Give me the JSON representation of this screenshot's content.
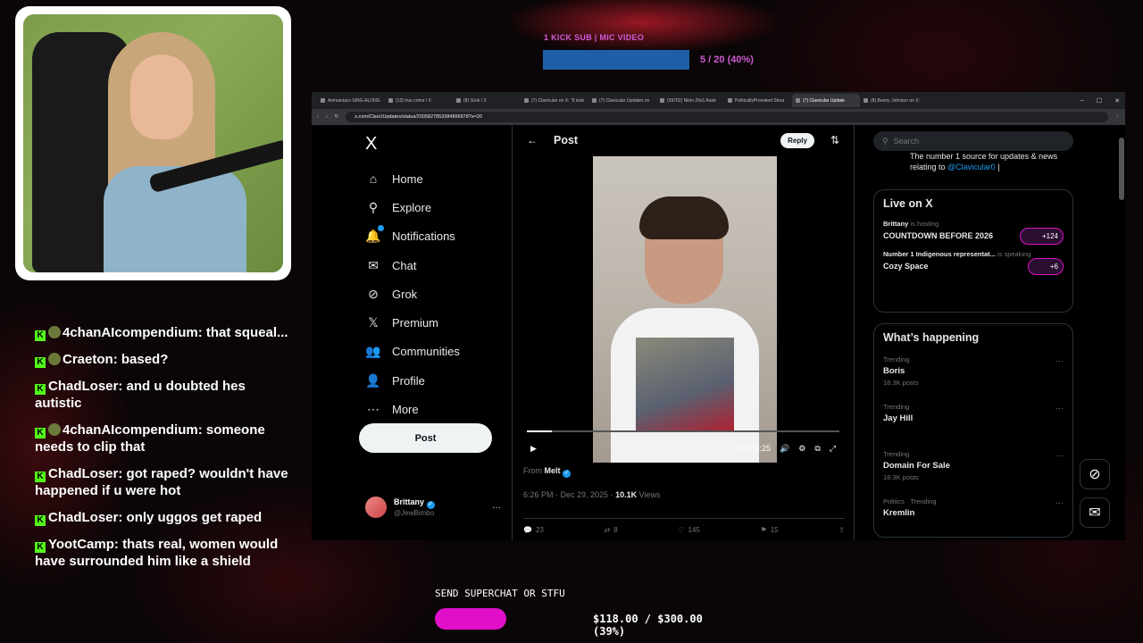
{
  "overlay": {
    "top_label": "1 KICK SUB | MIC VIDEO",
    "top_progress": "5 / 20 (40%)",
    "superchat_label": "SEND SUPERCHAT OR STFU",
    "superchat_progress": "$118.00 / $300.00 (39%)",
    "superchat_fraction": 0.39
  },
  "chat": [
    {
      "user": "4chanAIcompendium",
      "text": "that squeal..."
    },
    {
      "user": "Craeton",
      "text": "based?"
    },
    {
      "user": "ChadLoser",
      "text": "and u doubted hes autistic"
    },
    {
      "user": "4chanAIcompendium",
      "text": "someone needs to clip that"
    },
    {
      "user": "ChadLoser",
      "text": "got raped? wouldn't have happened if u were hot"
    },
    {
      "user": "ChadLoser",
      "text": "only uggos get raped"
    },
    {
      "user": "YootCamp",
      "text": "thats real, women would have surrounded him like a shield"
    }
  ],
  "browser": {
    "tabs": [
      "Animaniacs SING-ALONG",
      "(13) true crime / X",
      "(8) Grok / X",
      "(7) Clavicular on X: \"It look",
      "(7) Clavicular Updates on",
      "(39702) Nilon 20x1 Austr",
      "PoliticallyProvoked Strea",
      "(7) Clavicular Update",
      "(8) Benny Johnson on X:"
    ],
    "url": "x.com/ClavUUpdates/status/2005827853384896978?s=20"
  },
  "x_nav": {
    "logo": "X",
    "items": [
      {
        "label": "Home",
        "icon": "home-icon",
        "glyph": "⌂"
      },
      {
        "label": "Explore",
        "icon": "search-icon",
        "glyph": "⚲"
      },
      {
        "label": "Notifications",
        "icon": "bell-icon",
        "glyph": "🔔"
      },
      {
        "label": "Chat",
        "icon": "mail-icon",
        "glyph": "✉"
      },
      {
        "label": "Grok",
        "icon": "grok-icon",
        "glyph": "⊘"
      },
      {
        "label": "Premium",
        "icon": "x-premium-icon",
        "glyph": "𝕏"
      },
      {
        "label": "Communities",
        "icon": "people-icon",
        "glyph": "👥"
      },
      {
        "label": "Profile",
        "icon": "person-icon",
        "glyph": "👤"
      },
      {
        "label": "More",
        "icon": "more-circle-icon",
        "glyph": "⋯"
      }
    ],
    "post_button": "Post",
    "profile_name": "Brittany",
    "profile_handle": "@JewBimbo"
  },
  "post": {
    "header_title": "Post",
    "reply_label": "Reply",
    "video_time": "0:02 / 0:25",
    "video_progress": 0.08,
    "from_label": "From",
    "from_name": "Melt",
    "timestamp": "6:26 PM · Dec 29, 2025 · ",
    "views_count": "10.1K",
    "views_label": " Views",
    "replies": "23",
    "reposts": "8",
    "likes": "145",
    "bookmarks": "15"
  },
  "sidebar": {
    "search_placeholder": "Search",
    "snippet_text": "The number 1 source for updates & news relating to ",
    "snippet_link": "@Clavicular0",
    "snippet_tail": " |",
    "live_title": "Live on X",
    "live": [
      {
        "host": "Brittany",
        "status": " is hosting",
        "title": "COUNTDOWN BEFORE 2026",
        "count": "+124"
      },
      {
        "host": "Number 1 Indigenous representat...",
        "status": " is speaking",
        "title": "Cozy Space",
        "count": "+6"
      }
    ],
    "trends_title": "What’s happening",
    "trends": [
      {
        "category": "Trending",
        "name": "Boris",
        "count": "18.3K posts"
      },
      {
        "category": "Trending",
        "name": "Jay Hill",
        "count": ""
      },
      {
        "category": "Trending",
        "name": "Domain For Sale",
        "count": "18.3K posts"
      },
      {
        "category": "Politics · Trending",
        "name": "Kremlin",
        "count": ""
      }
    ]
  },
  "colors": {
    "accent": "#1d9bf0",
    "superchat": "#e010c8",
    "kick": "#53fc18"
  }
}
